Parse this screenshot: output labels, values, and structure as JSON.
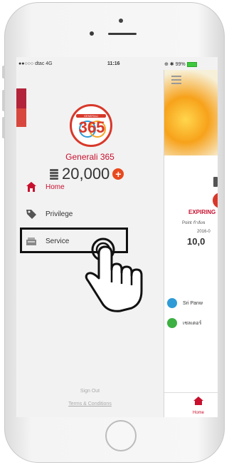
{
  "status_bar": {
    "carrier": "●●○○○ dtac  4G",
    "time": "11:16",
    "right": "⊕ ✱ 99%"
  },
  "drawer": {
    "logo_top_text": "GENERALI",
    "logo_number": "365",
    "brand_name": "Generali 365",
    "points": "20,000",
    "menu": [
      {
        "label": "Home",
        "active": true
      },
      {
        "label": "Privilege",
        "active": false
      },
      {
        "label": "Service",
        "active": false
      }
    ],
    "sign_out": "Sign Out",
    "terms": "Terms & Conditions"
  },
  "main": {
    "expiring": "EXPIRING",
    "line1": "Point กำลังจ",
    "line2": "2016-0",
    "points": "10,0",
    "rows": [
      {
        "label": "Sri Panw",
        "color": "#2e9bd6"
      },
      {
        "label": "เซลเตอร์",
        "color": "#3cb043"
      }
    ],
    "tab_home": "Home"
  },
  "colors": {
    "brand_red": "#c8102e",
    "accent_orange": "#e8491d",
    "highlight_border": "#111111"
  }
}
